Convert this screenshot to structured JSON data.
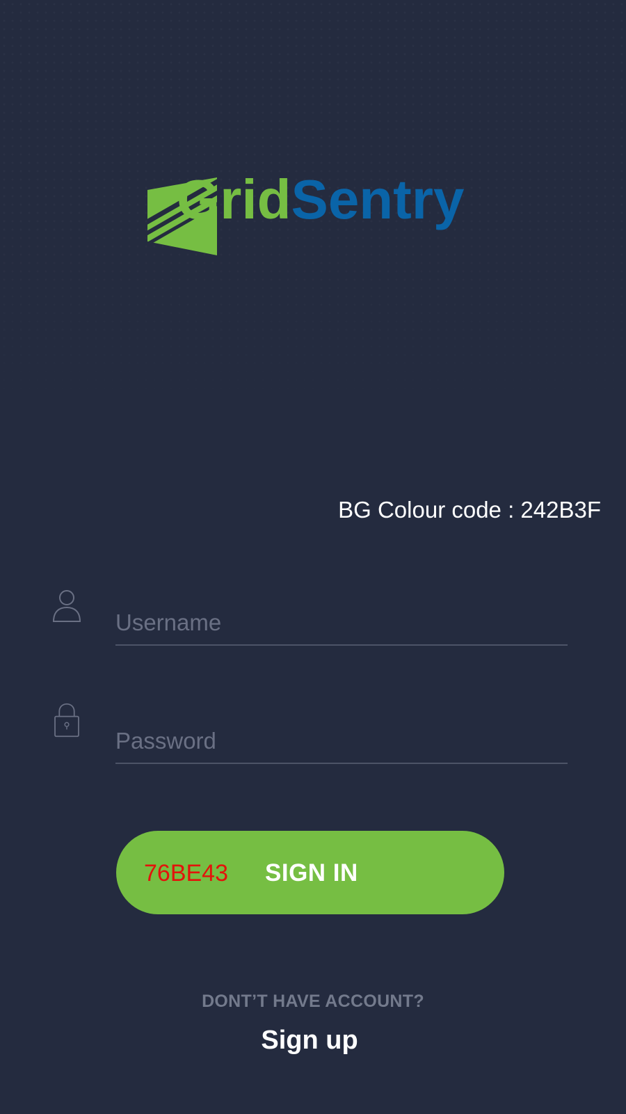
{
  "app": {
    "brand": {
      "part1": "Grid",
      "part2": "Sentry",
      "colors": {
        "grid": "#76BE43",
        "sentry": "#0A64A8"
      }
    },
    "background_color": "#242B3F"
  },
  "annotation": {
    "bg_colour_text": "BG Colour code : 242B3F"
  },
  "form": {
    "username": {
      "placeholder": "Username",
      "value": "",
      "icon": "user-icon"
    },
    "password": {
      "placeholder": "Password",
      "value": "",
      "icon": "lock-icon"
    },
    "sign_in": {
      "color_code_label": "76BE43",
      "label": "SIGN IN",
      "color": "#76BE43"
    }
  },
  "footer": {
    "no_account": "DONT’T HAVE ACCOUNT?",
    "sign_up": "Sign up"
  }
}
